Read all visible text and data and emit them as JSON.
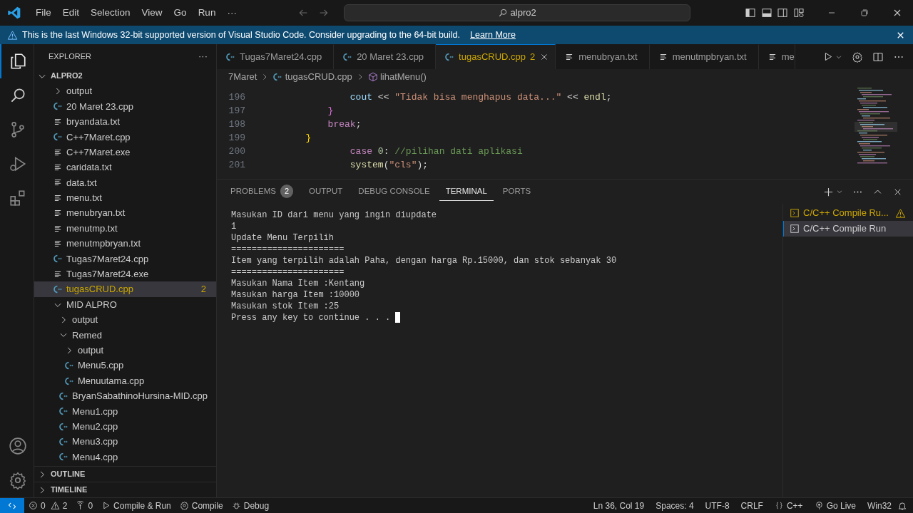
{
  "title_bar": {
    "menu": [
      "File",
      "Edit",
      "Selection",
      "View",
      "Go",
      "Run",
      "···"
    ],
    "search": "alpro2"
  },
  "banner": {
    "message": "This is the last Windows 32-bit supported version of Visual Studio Code. Consider upgrading to the 64-bit build.",
    "link": "Learn More"
  },
  "sidebar": {
    "title": "EXPLORER",
    "more": "···",
    "root": {
      "label": "ALPRO2",
      "expanded": true
    },
    "tree": [
      {
        "label": "output",
        "kind": "folder",
        "expanded": false,
        "selected": false
      },
      {
        "label": "20 Maret 23.cpp",
        "kind": "cpp",
        "selected": false
      },
      {
        "label": "bryandata.txt",
        "kind": "txt",
        "selected": false
      },
      {
        "label": "C++7Maret.cpp",
        "kind": "cpp",
        "selected": false
      },
      {
        "label": "C++7Maret.exe",
        "kind": "txt",
        "selected": false
      },
      {
        "label": "caridata.txt",
        "kind": "txt",
        "selected": false
      },
      {
        "label": "data.txt",
        "kind": "txt",
        "selected": false
      },
      {
        "label": "menu.txt",
        "kind": "txt",
        "selected": false
      },
      {
        "label": "menubryan.txt",
        "kind": "txt",
        "selected": false
      },
      {
        "label": "menutmp.txt",
        "kind": "txt",
        "selected": false
      },
      {
        "label": "menutmpbryan.txt",
        "kind": "txt",
        "selected": false
      },
      {
        "label": "Tugas7Maret24.cpp",
        "kind": "cpp",
        "selected": false
      },
      {
        "label": "Tugas7Maret24.exe",
        "kind": "txt",
        "selected": false
      },
      {
        "label": "tugasCRUD.cpp",
        "kind": "cpp",
        "selected": true,
        "badge": "2"
      },
      {
        "label": "MID ALPRO",
        "kind": "folder",
        "expanded": true,
        "selected": false,
        "children": [
          {
            "label": "output",
            "kind": "folder",
            "expanded": false,
            "selected": false
          },
          {
            "label": "Remed",
            "kind": "folder",
            "expanded": true,
            "selected": false,
            "children": [
              {
                "label": "output",
                "kind": "folder",
                "expanded": false,
                "selected": false
              },
              {
                "label": "Menu5.cpp",
                "kind": "cpp",
                "selected": false
              },
              {
                "label": "Menuutama.cpp",
                "kind": "cpp",
                "selected": false
              }
            ]
          },
          {
            "label": "BryanSabathinoHursina-MID.cpp",
            "kind": "cpp",
            "selected": false
          },
          {
            "label": "Menu1.cpp",
            "kind": "cpp",
            "selected": false
          },
          {
            "label": "Menu2.cpp",
            "kind": "cpp",
            "selected": false
          },
          {
            "label": "Menu3.cpp",
            "kind": "cpp",
            "selected": false
          },
          {
            "label": "Menu4.cpp",
            "kind": "cpp",
            "selected": false
          }
        ]
      }
    ],
    "sections": [
      {
        "label": "OUTLINE",
        "expanded": false
      },
      {
        "label": "TIMELINE",
        "expanded": false
      }
    ]
  },
  "editor_tabs": [
    {
      "label": "Tugas7Maret24.cpp",
      "kind": "cpp",
      "selected": false,
      "has_problems": false
    },
    {
      "label": "20 Maret 23.cpp",
      "kind": "cpp",
      "selected": false,
      "has_problems": false
    },
    {
      "label": "tugasCRUD.cpp",
      "kind": "cpp",
      "selected": true,
      "has_problems": true,
      "badge": "2"
    },
    {
      "label": "menubryan.txt",
      "kind": "txt",
      "selected": false,
      "has_problems": false
    },
    {
      "label": "menutmpbryan.txt",
      "kind": "txt",
      "selected": false,
      "has_problems": false
    },
    {
      "label": "me",
      "kind": "txt",
      "selected": false,
      "has_problems": false
    }
  ],
  "breadcrumb": [
    {
      "label": "7Maret",
      "kind": "folder"
    },
    {
      "label": "tugasCRUD.cpp",
      "kind": "cpp"
    },
    {
      "label": "lihatMenu()",
      "kind": "method"
    }
  ],
  "code": [
    {
      "number": "196",
      "tokens": [
        {
          "text": "                cout",
          "kind": "variable"
        },
        {
          "text": " << ",
          "kind": "plain"
        },
        {
          "text": "\"Tidak bisa menghapus data...\"",
          "kind": "string"
        },
        {
          "text": " << ",
          "kind": "plain"
        },
        {
          "text": "endl",
          "kind": "function"
        },
        {
          "text": ";",
          "kind": "plain"
        }
      ]
    },
    {
      "number": "197",
      "tokens": [
        {
          "text": "            }",
          "kind": "brace2"
        }
      ]
    },
    {
      "number": "198",
      "tokens": [
        {
          "text": "            break",
          "kind": "keyword"
        },
        {
          "text": ";",
          "kind": "plain"
        }
      ]
    },
    {
      "number": "199",
      "tokens": [
        {
          "text": "        }",
          "kind": "brace1"
        }
      ]
    },
    {
      "number": "200",
      "tokens": [
        {
          "text": "                case",
          "kind": "keyword"
        },
        {
          "text": " 0",
          "kind": "number"
        },
        {
          "text": ": ",
          "kind": "plain"
        },
        {
          "text": "//pilihan dati aplikasi",
          "kind": "comment"
        }
      ]
    },
    {
      "number": "201",
      "tokens": [
        {
          "text": "                system",
          "kind": "function"
        },
        {
          "text": "(",
          "kind": "plain"
        },
        {
          "text": "\"cls\"",
          "kind": "string"
        },
        {
          "text": ");",
          "kind": "plain"
        }
      ]
    }
  ],
  "panel": {
    "tabs": [
      {
        "label": "PROBLEMS",
        "badge": "2",
        "selected": false
      },
      {
        "label": "OUTPUT",
        "selected": false
      },
      {
        "label": "DEBUG CONSOLE",
        "selected": false
      },
      {
        "label": "TERMINAL",
        "selected": true
      },
      {
        "label": "PORTS",
        "selected": false
      }
    ],
    "terminal_lines": [
      "Masukan ID dari menu yang ingin diupdate",
      "1",
      "Update Menu Terpilih",
      "======================",
      "Item yang terpilih adalah Paha, dengan harga Rp.15000, dan stok sebanyak 30",
      "======================",
      "Masukan Nama Item :Kentang",
      "Masukan harga Item :10000",
      "Masukan stok Item :25",
      "Press any key to continue . . ."
    ],
    "cursor": true,
    "terminals": [
      {
        "label": "C/C++ Compile Ru...",
        "warning": true,
        "selected": false
      },
      {
        "label": "C/C++ Compile Run",
        "warning": false,
        "selected": true
      }
    ]
  },
  "status_bar": {
    "errors": "0",
    "warnings": "2",
    "ports": "0",
    "left": [
      {
        "label": "Compile & Run",
        "kind": "run"
      },
      {
        "label": "Compile",
        "kind": "gear"
      },
      {
        "label": "Debug",
        "kind": "bug"
      }
    ],
    "right": [
      {
        "label": "Ln 36, Col 19",
        "kind": "text"
      },
      {
        "label": "Spaces: 4",
        "kind": "text"
      },
      {
        "label": "UTF-8",
        "kind": "text"
      },
      {
        "label": "CRLF",
        "kind": "text"
      },
      {
        "label": "C++",
        "kind": "braces"
      },
      {
        "label": "Go Live",
        "kind": "live"
      },
      {
        "label": "Win32",
        "kind": "text"
      }
    ]
  }
}
